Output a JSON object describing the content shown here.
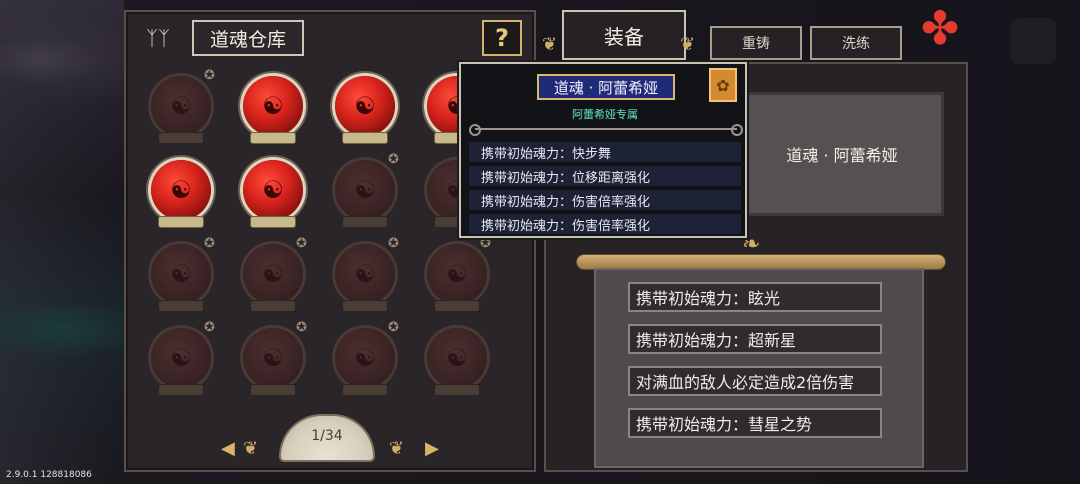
{
  "storage": {
    "title": "道魂仓库",
    "help_label": "?",
    "page_indicator": "1/34",
    "prev_label": "◀",
    "next_label": "▶",
    "slots": [
      {
        "state": "off",
        "starred": true
      },
      {
        "state": "on",
        "starred": false
      },
      {
        "state": "on",
        "starred": false
      },
      {
        "state": "on",
        "starred": false
      },
      {
        "state": "on",
        "starred": false
      },
      {
        "state": "on",
        "starred": false
      },
      {
        "state": "off",
        "starred": true
      },
      {
        "state": "off",
        "starred": false
      },
      {
        "state": "off",
        "starred": true
      },
      {
        "state": "off",
        "starred": true
      },
      {
        "state": "off",
        "starred": true
      },
      {
        "state": "off",
        "starred": true
      },
      {
        "state": "off",
        "starred": true
      },
      {
        "state": "off",
        "starred": true
      },
      {
        "state": "off",
        "starred": true
      },
      {
        "state": "off",
        "starred": false
      }
    ]
  },
  "tabs": {
    "equip": "装备",
    "reforge": "重铸",
    "wash": "洗练"
  },
  "equip": {
    "item_name": "道魂 · 阿蕾希娅",
    "effects": [
      "携带初始魂力：眩光",
      "携带初始魂力：超新星",
      "对满血的敌人必定造成2倍伤害",
      "携带初始魂力：彗星之势"
    ]
  },
  "tooltip": {
    "name": "道魂 · 阿蕾希娅",
    "subtitle": "阿蕾希娅专属",
    "rows": [
      "携带初始魂力：快步舞",
      "携带初始魂力：位移距离强化",
      "携带初始魂力：伤害倍率强化",
      "携带初始魂力：伤害倍率强化"
    ]
  },
  "version_text": "2.9.0.1 128818086",
  "colors": {
    "active_orb": "#d8241c",
    "inactive_orb": "#3d2526",
    "tooltip_name_bg": "#1f2b78",
    "accent_gold": "#d9b66c",
    "subtitle_cyan": "#62e4c8"
  }
}
